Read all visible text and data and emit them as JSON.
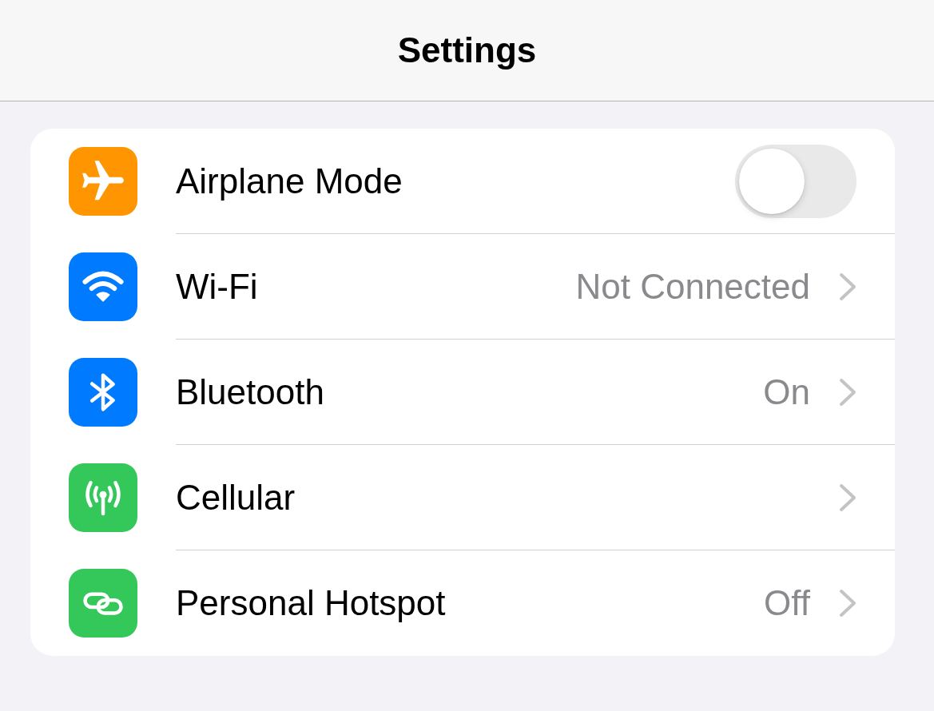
{
  "nav_bar": {
    "title": "Settings"
  },
  "rows": [
    {
      "kind": "toggle",
      "label": "Airplane Mode",
      "color": "#ff9500",
      "on": false
    },
    {
      "kind": "link",
      "label": "Wi-Fi",
      "value": "Not Connected",
      "color": "#007aff"
    },
    {
      "kind": "link",
      "label": "Bluetooth",
      "value": "On",
      "color": "#007aff"
    },
    {
      "kind": "link",
      "label": "Cellular",
      "color": "#34c759"
    },
    {
      "kind": "link",
      "label": "Personal Hotspot",
      "value": "Off",
      "color": "#34c759"
    }
  ]
}
